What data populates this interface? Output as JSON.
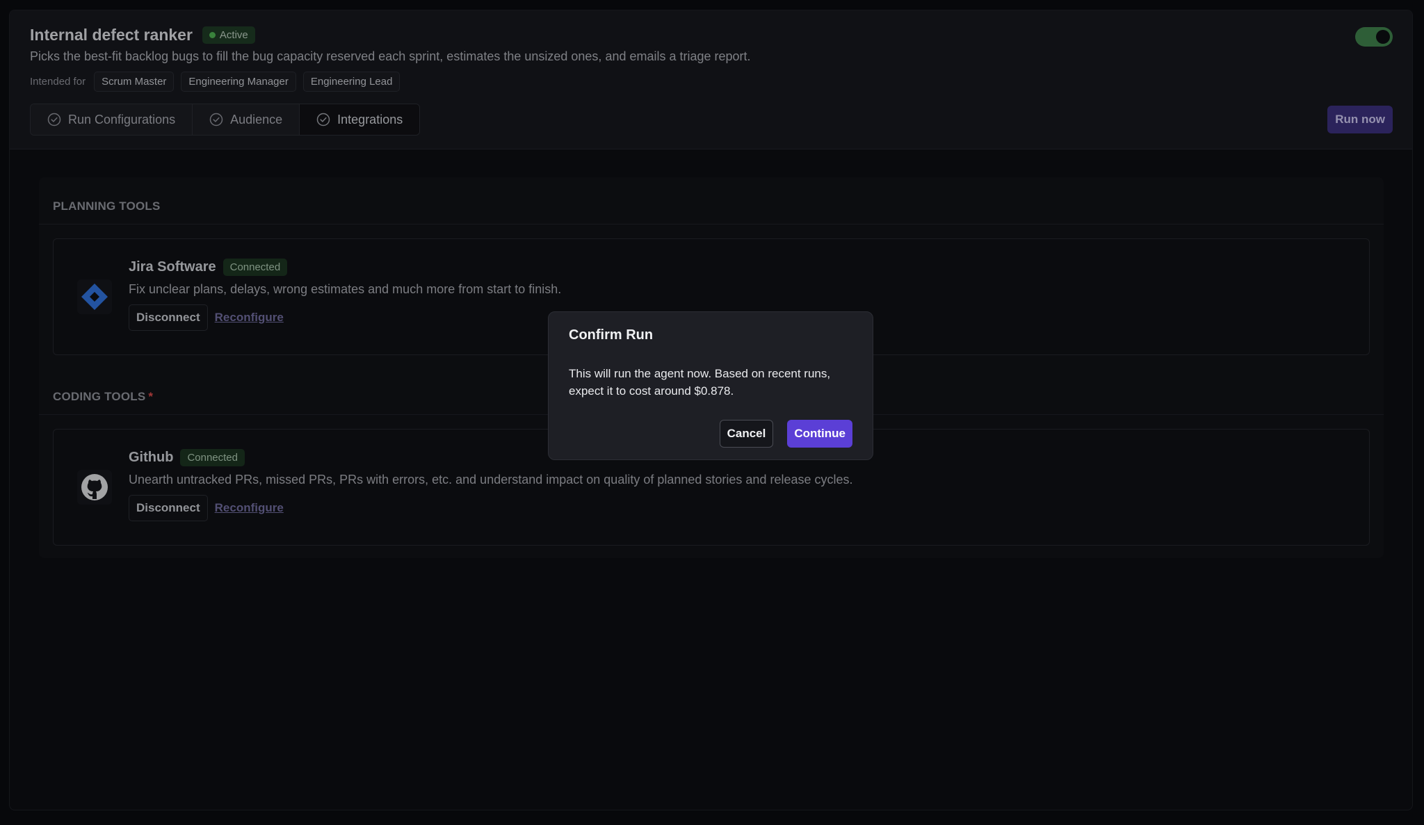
{
  "header": {
    "title": "Internal defect ranker",
    "status": "Active",
    "description": "Picks the best-fit backlog bugs to fill the bug capacity reserved each sprint, estimates the unsized ones, and emails a triage report.",
    "intended_for_label": "Intended for",
    "audience_tags": [
      "Scrum Master",
      "Engineering Manager",
      "Engineering Lead"
    ],
    "toggle_on": true,
    "run_now_label": "Run now"
  },
  "tabs": [
    {
      "label": "Run Configurations",
      "icon": "check-circle-icon"
    },
    {
      "label": "Audience",
      "icon": "check-circle-icon"
    },
    {
      "label": "Integrations",
      "icon": "check-circle-icon",
      "active": true
    }
  ],
  "sections": {
    "planning": {
      "title": "PLANNING TOOLS",
      "integration": {
        "name": "Jira Software",
        "status": "Connected",
        "description": "Fix unclear plans, delays, wrong estimates and much more from start to finish.",
        "disconnect_label": "Disconnect",
        "reconfigure_label": "Reconfigure",
        "icon": "jira-icon"
      }
    },
    "coding": {
      "title": "CODING TOOLS",
      "required_marker": "*",
      "integration": {
        "name": "Github",
        "status": "Connected",
        "description": "Unearth untracked PRs, missed PRs, PRs with errors, etc. and understand impact on quality of planned stories and release cycles.",
        "disconnect_label": "Disconnect",
        "reconfigure_label": "Reconfigure",
        "icon": "github-icon"
      }
    }
  },
  "modal": {
    "title": "Confirm Run",
    "body": "This will run the agent now. Based on recent runs, expect it to cost around $0.878.",
    "cancel_label": "Cancel",
    "continue_label": "Continue"
  },
  "colors": {
    "accent": "#5b3fd6",
    "connected_bg": "#1b3321",
    "active_dot": "#4caf50"
  }
}
